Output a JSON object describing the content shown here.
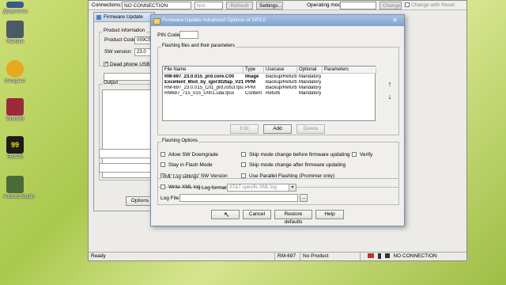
{
  "desktop": {
    "icons": [
      {
        "label": "Документы",
        "color": "#3a5a8c"
      },
      {
        "label": "Warface",
        "color": "#4a5a66"
      },
      {
        "label": "Интернет",
        "color": "#e6a81e"
      },
      {
        "label": "WinRAR",
        "color": "#9b2b3a"
      },
      {
        "label": "FRAPS",
        "color": "#1c1c1c"
      },
      {
        "label": "Android Studio",
        "color": "#4b6b3a"
      }
    ],
    "fraps_counter": "99"
  },
  "toolbar": {
    "connections_label": "Connections:",
    "connections_value": "NO CONNECTION",
    "na_value": "N/A",
    "refresh_label": "Refresh",
    "settings_label": "Settings...",
    "operating_mode_label": "Operating mode:",
    "change_label": "Change",
    "change_with_reset_label": "Change with Reset"
  },
  "firmware_panel": {
    "title": "Firmware Update",
    "product_info_label": "Product information",
    "product_code_label": "Product Code:",
    "product_code_value": "059C5",
    "sw_version_label": "SW version:",
    "sw_version_value": "23.0",
    "dead_phone_label": "Dead phone USB fl",
    "output_label": "Output",
    "options_button": "Options"
  },
  "modal": {
    "title": "Firmware Update Advanced Options of DP2.0",
    "close_glyph": "✕",
    "pin_code_label": "PIN Code:",
    "flashing_files_label": "Flashing files and their parameters",
    "columns": [
      "File Name",
      "Type",
      "Usecase",
      "Optional",
      "Parameters"
    ],
    "rows": [
      {
        "file": "RM-697_23.0.015_prd.core.C00",
        "type": "Image",
        "usecase": "Backup/Refurb",
        "optional": "Mandatory",
        "params": "",
        "bold": true
      },
      {
        "file": "Excellent_Mod_by_igor302tap_V21",
        "type": "PPM",
        "usecase": "Backup/Refurb",
        "optional": "Mandatory",
        "params": "",
        "bold": true
      },
      {
        "file": "RM-697_23.0.015_C01_prd.rofs3.fpsx",
        "type": "PPM",
        "usecase": "Backup/Refurb",
        "optional": "Mandatory",
        "params": "",
        "bold": false
      },
      {
        "file": "RM697_715_015_U001.uda.fpsx",
        "type": "Content",
        "usecase": "Refurb",
        "optional": "Mandatory",
        "params": "",
        "bold": false
      }
    ],
    "up_glyph": "↑",
    "down_glyph": "↓",
    "edit_button": "Edit",
    "add_button": "Add",
    "delete_button": "Delete",
    "flashing_options_label": "Flashing Options",
    "options": [
      {
        "label": "Allow SW Downgrade",
        "checked": false
      },
      {
        "label": "Skip mode change before firmware updating",
        "checked": false
      },
      {
        "label": "Verify",
        "checked": false
      },
      {
        "label": "Stay in Flash Mode",
        "checked": false
      },
      {
        "label": "Skip mode change after firmware updating",
        "checked": false
      },
      {
        "label": "Ignore Invalid SW Version",
        "checked": false
      },
      {
        "label": "Use Parallel Flashing (Prommer only)",
        "checked": false
      }
    ],
    "xml_log_settings_label": "XML Log settings",
    "write_xml_log_label": "Write XML log",
    "log_format_label": "Log format:",
    "log_format_value": "AT&T specific XML log",
    "log_file_label": "Log File:",
    "browse_label": "...",
    "ok_button": "",
    "cancel_button": "Cancel",
    "restore_defaults_button": "Restore defaults",
    "help_button": "Help"
  },
  "statusbar": {
    "ready": "Ready",
    "model": "RM-697",
    "product": "No Product",
    "connection": "NO CONNECTION"
  }
}
